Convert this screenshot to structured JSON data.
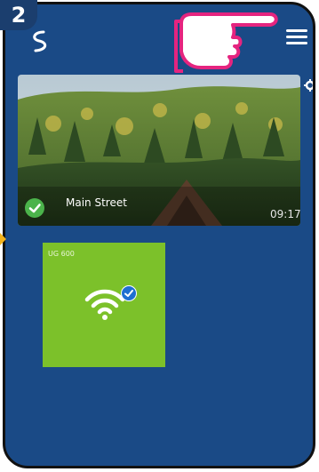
{
  "step_badge": "2",
  "app": {
    "background_color": "#1a4a86",
    "logo_icon": "swirl-logo-icon",
    "menu_icon": "hamburger-menu-icon"
  },
  "camera": {
    "name": "Main Street",
    "time": "09:17",
    "status_icon": "check-circle-icon",
    "settings_icon": "gear-icon"
  },
  "device": {
    "name": "UG 600",
    "tile_color": "#7cc12a",
    "icon": "wifi-icon",
    "status_icon": "check-badge-icon"
  },
  "overlay": {
    "pointer_icon": "pointing-hand-icon",
    "marker_color": "#f2b21b"
  }
}
